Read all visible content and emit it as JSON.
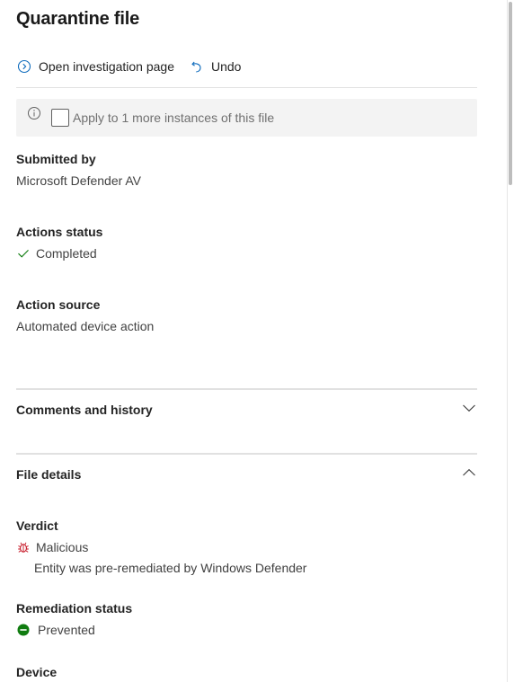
{
  "panel": {
    "title": "Quarantine file"
  },
  "commands": {
    "open_investigation": "Open investigation page",
    "undo": "Undo"
  },
  "apply": {
    "label": "Apply to 1 more instances of this file",
    "checked": false
  },
  "submitted_by": {
    "label": "Submitted by",
    "value": "Microsoft Defender AV"
  },
  "actions_status": {
    "label": "Actions status",
    "value": "Completed"
  },
  "action_source": {
    "label": "Action source",
    "value": "Automated device action"
  },
  "comments_section": {
    "title": "Comments and history",
    "expanded": false
  },
  "file_details": {
    "title": "File details",
    "expanded": true,
    "verdict": {
      "label": "Verdict",
      "value": "Malicious",
      "note": "Entity was pre-remediated by Windows Defender"
    },
    "remediation_status": {
      "label": "Remediation status",
      "value": "Prevented"
    },
    "device": {
      "label": "Device"
    }
  },
  "colors": {
    "accent": "#0f6cbd",
    "success_check": "#107c10",
    "malicious": "#c50f1f",
    "prevented": "#107c10",
    "divider": "#e1e1e1",
    "info_bg": "#f3f3f3"
  },
  "icons": {
    "open_investigation": "chevron-circle-right-icon",
    "undo": "undo-icon",
    "info": "info-icon",
    "completed": "checkmark-icon",
    "collapse": "chevron-down-icon",
    "expand": "chevron-up-icon",
    "malicious": "bug-icon",
    "prevented": "blocked-circle-icon"
  }
}
